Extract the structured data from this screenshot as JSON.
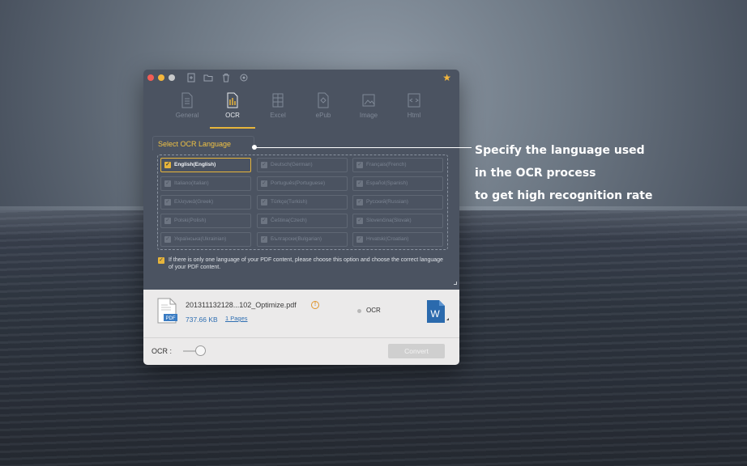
{
  "window": {
    "tabs": [
      {
        "label": "General",
        "icon": "document-icon"
      },
      {
        "label": "OCR",
        "icon": "ocr-icon"
      },
      {
        "label": "Excel",
        "icon": "excel-icon"
      },
      {
        "label": "ePub",
        "icon": "epub-icon"
      },
      {
        "label": "Image",
        "icon": "image-icon"
      },
      {
        "label": "Html",
        "icon": "html-icon"
      }
    ],
    "active_tab": "OCR",
    "group_title": "Select OCR Language",
    "languages": [
      "English(English)",
      "Deutsch(German)",
      "Français(French)",
      "Italiano(Italian)",
      "Português(Portuguese)",
      "Español(Spanish)",
      "Ελληνικά(Greek)",
      "Türkçe(Turkish)",
      "Русский(Russian)",
      "Polski(Polish)",
      "Čeština(Czech)",
      "Slovenčina(Slovak)",
      "Українська(Ukrainian)",
      "Български(Bulgarian)",
      "Hrvatski(Croatian)"
    ],
    "selected_language": "English(English)",
    "note": "If there is only one language of your PDF content, please choose this option and choose the correct language of your PDF content.",
    "file": {
      "name": "201311132128...102_Optimize.pdf",
      "size": "737.66 KB",
      "pages": "1 Pages",
      "output_mode": "OCR",
      "warn_symbol": "!",
      "pdf_badge": "PDF",
      "word_letter": "W"
    },
    "ocr_toggle_label": "OCR :",
    "convert_label": "Convert"
  },
  "callout": {
    "lines": [
      "Specify the language used",
      "in the OCR process",
      "to get high recognition rate"
    ]
  },
  "colors": {
    "accent": "#e7b53b",
    "link": "#2f6fb2",
    "window_bg": "#4b5361"
  }
}
